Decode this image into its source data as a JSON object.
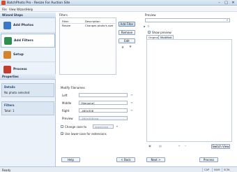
{
  "window": {
    "title": "BatchPhoto Pro - Resize For Auction Site",
    "controls": [
      "–",
      "□",
      "✕"
    ]
  },
  "menu": [
    "File",
    "View",
    "Wizard",
    "Help"
  ],
  "sidebar": {
    "header": "Wizard Steps",
    "steps": [
      {
        "label": "Add Photos",
        "icon": "add-photos-icon",
        "color": "#3b78c7"
      },
      {
        "label": "Add Filters",
        "icon": "add-filters-icon",
        "color": "#2d8f4e"
      },
      {
        "label": "Setup",
        "icon": "setup-icon",
        "color": "#d3842a"
      },
      {
        "label": "Process",
        "icon": "process-icon",
        "color": "#c43c2d"
      }
    ],
    "properties": {
      "header": "Properties",
      "details_title": "Details",
      "details_value": "No photo selected",
      "filters_title": "Filters",
      "filters_value": "Total: 1"
    }
  },
  "filters": {
    "label": "Filters",
    "columns": [
      "Filter",
      "Description"
    ],
    "rows": [
      {
        "filter": "Resize",
        "description": "Changes photo's size"
      }
    ],
    "add_label": "Add Filter",
    "remove_label": "Remove",
    "edit_label": "Edit"
  },
  "modify": {
    "label": "Modify Filenames",
    "left_label": "Left",
    "left_value": "",
    "middle_label": "Middle",
    "middle_value": "[filename]",
    "right_label": "Right",
    "right_value": "-480x308",
    "preview_label": "Preview",
    "preview_value": "-480x308.jpg",
    "change_case_label": "Change case to",
    "change_case_option": "lowercase",
    "lower_ext_label": "Use lower-case for extensions"
  },
  "preview": {
    "label": "Preview",
    "show_preview_label": "Show preview",
    "tabs": [
      "Original",
      "Modified"
    ],
    "switch_view_label": "Switch View"
  },
  "nav": {
    "help": "Help",
    "back": "< Back",
    "next": "Next >",
    "process": "Process"
  },
  "status": {
    "text": "Ready",
    "cells": [
      "CAP",
      "NUM",
      "SCRL"
    ]
  }
}
